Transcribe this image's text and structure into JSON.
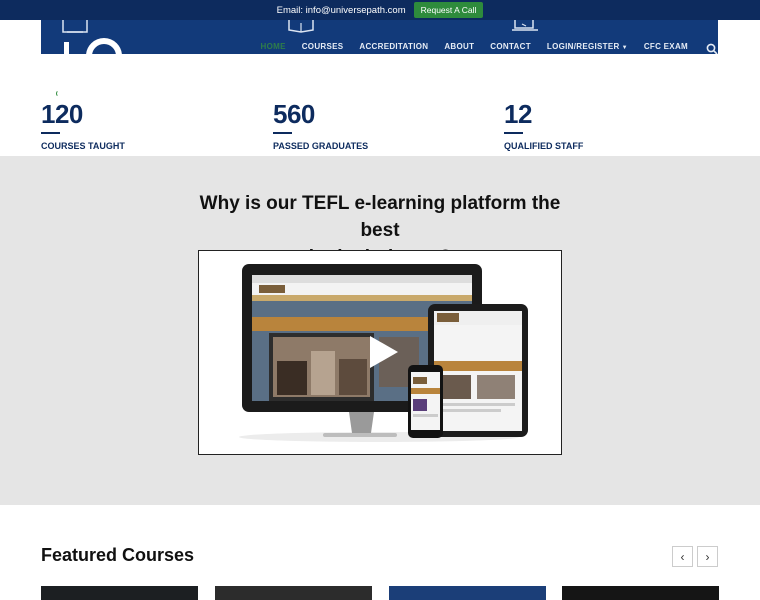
{
  "topbar": {
    "email_text": "Email: info@universepath.com",
    "request_button": "Request A Call",
    "bg_color": "#0d2b5e",
    "button_color": "#2e8b3c"
  },
  "nav": {
    "items": [
      {
        "label": "HOME",
        "active": true
      },
      {
        "label": "COURSES",
        "active": false
      },
      {
        "label": "ACCREDITATION",
        "active": false
      },
      {
        "label": "ABOUT",
        "active": false
      },
      {
        "label": "CONTACT",
        "active": false
      },
      {
        "label": "LOGIN/REGISTER",
        "active": false,
        "dropdown": true
      },
      {
        "label": "CFC EXAM",
        "active": false
      }
    ],
    "bg_color": "#123a7a",
    "active_color": "#2e7d4a"
  },
  "stats": [
    {
      "value": "120",
      "label": "COURSES TAUGHT"
    },
    {
      "value": "560",
      "label": "PASSED GRADUATES"
    },
    {
      "value": "12",
      "label": "QUALIFIED STAFF"
    }
  ],
  "promo": {
    "heading_line1": "Why is our TEFL e-learning platform the best",
    "heading_line2": "in the industry?",
    "video_icon": "play-icon"
  },
  "featured": {
    "title": "Featured Courses",
    "prev_icon": "chevron-left-icon",
    "next_icon": "chevron-right-icon"
  },
  "colors": {
    "brand_navy": "#0d2b5e",
    "brand_green": "#2e8b3c",
    "section_gray": "#e5e5e5"
  }
}
